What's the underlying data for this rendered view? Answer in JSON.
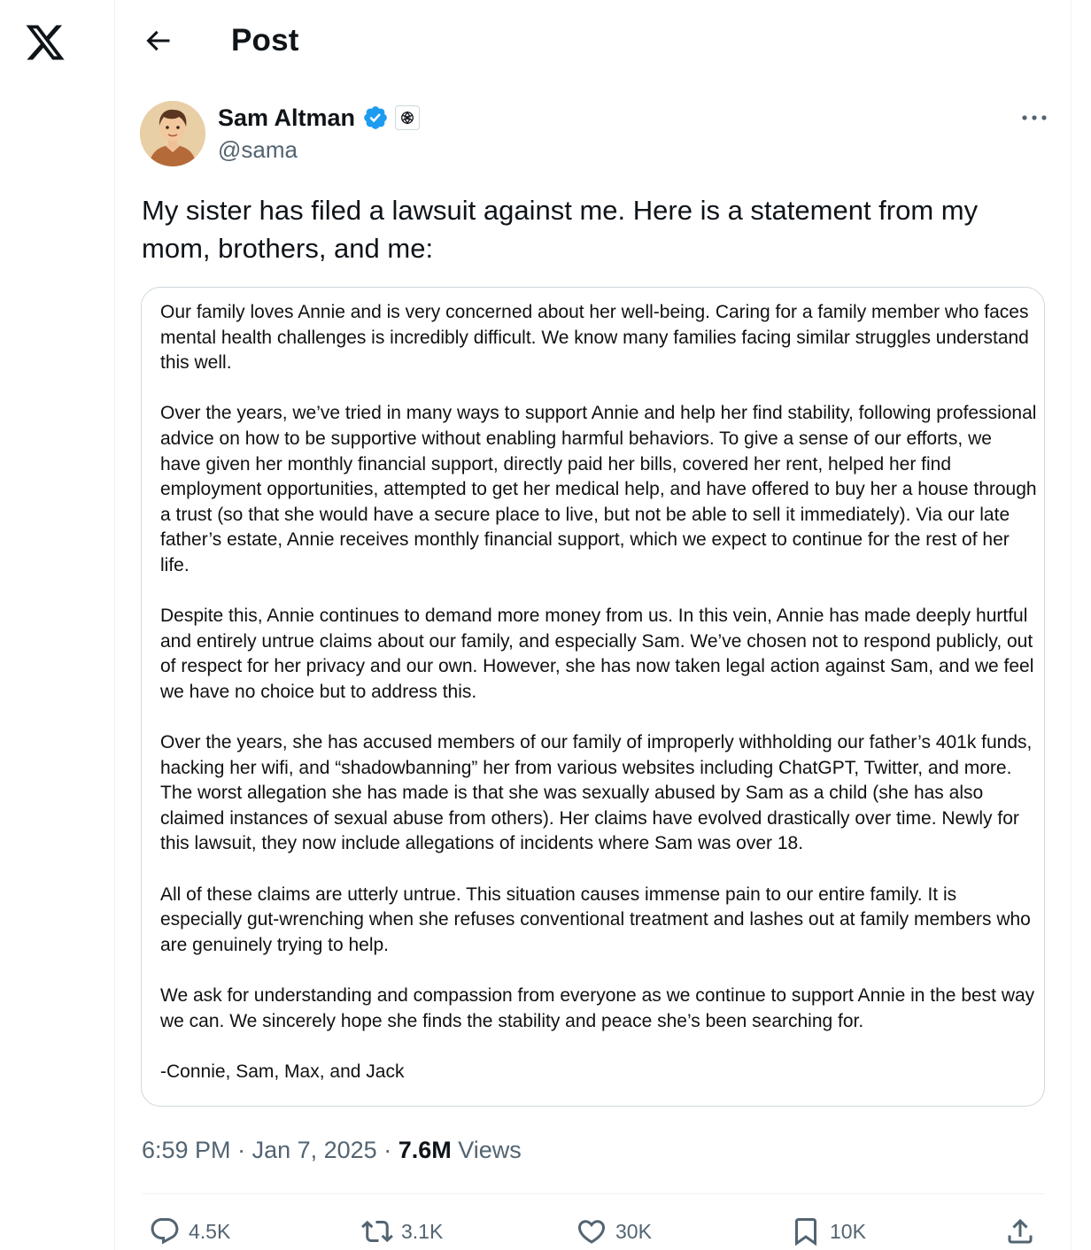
{
  "nav": {
    "logo_icon": "x-logo",
    "back_icon": "arrow-left-icon"
  },
  "header": {
    "title": "Post"
  },
  "author": {
    "name": "Sam Altman",
    "handle": "@sama",
    "verified_icon": "verified-badge-icon",
    "affiliation_icon": "openai-logo-icon",
    "more_icon": "more-horizontal-icon"
  },
  "post": {
    "text": "My sister has filed a lawsuit against me. Here is a statement from my mom, brothers, and me:",
    "statement_paragraphs": [
      "Our family loves Annie and is very concerned about her well-being. Caring for a family member who faces mental health challenges is incredibly difficult. We know many families facing similar struggles understand this well.",
      "Over the years, we’ve tried in many ways to support Annie and help her find stability, following professional advice on how to be supportive without enabling harmful behaviors. To give a sense of our efforts, we have given her monthly financial support, directly paid her bills, covered her rent, helped her find employment opportunities, attempted to get her medical help, and have offered to buy her a house through a trust (so that she would have a secure place to live, but not be able to sell it immediately). Via our late father’s estate, Annie receives monthly financial support, which we expect to continue for the rest of her life.",
      "Despite this, Annie continues to demand more money from us. In this vein, Annie has made deeply hurtful and entirely untrue claims about our family, and especially Sam. We’ve chosen not to respond publicly, out of respect for her privacy and our own. However, she has now taken legal action against Sam, and we feel we have no choice but to address this.",
      "Over the years, she has accused members of our family of improperly withholding our father’s 401k funds, hacking her wifi, and “shadowbanning” her from various websites including ChatGPT, Twitter, and more. The worst allegation she has made is that she was sexually abused by Sam as a child (she has also claimed instances of sexual abuse from others). Her claims have evolved drastically over time. Newly for this lawsuit, they now include allegations of incidents where Sam was over 18.",
      "All of these claims are utterly untrue. This situation causes immense pain to our entire family. It is especially gut-wrenching when she refuses conventional treatment and lashes out at family members who are genuinely trying to help.",
      "We ask for understanding and compassion from everyone as we continue to support Annie in the best way we can. We sincerely hope she finds the stability and peace she’s been searching for.",
      "-Connie, Sam, Max, and Jack"
    ],
    "time": "6:59 PM",
    "separator": " · ",
    "date": "Jan 7, 2025",
    "views_count": "7.6M",
    "views_label": " Views"
  },
  "actions": [
    {
      "icon": "reply-icon",
      "count": "4.5K"
    },
    {
      "icon": "repost-icon",
      "count": "3.1K"
    },
    {
      "icon": "like-icon",
      "count": "30K"
    },
    {
      "icon": "bookmark-icon",
      "count": "10K"
    },
    {
      "icon": "share-icon",
      "count": ""
    }
  ],
  "colors": {
    "text": "#0f1419",
    "secondary": "#536471",
    "verified": "#1d9bf0",
    "border": "#cfd9de"
  }
}
